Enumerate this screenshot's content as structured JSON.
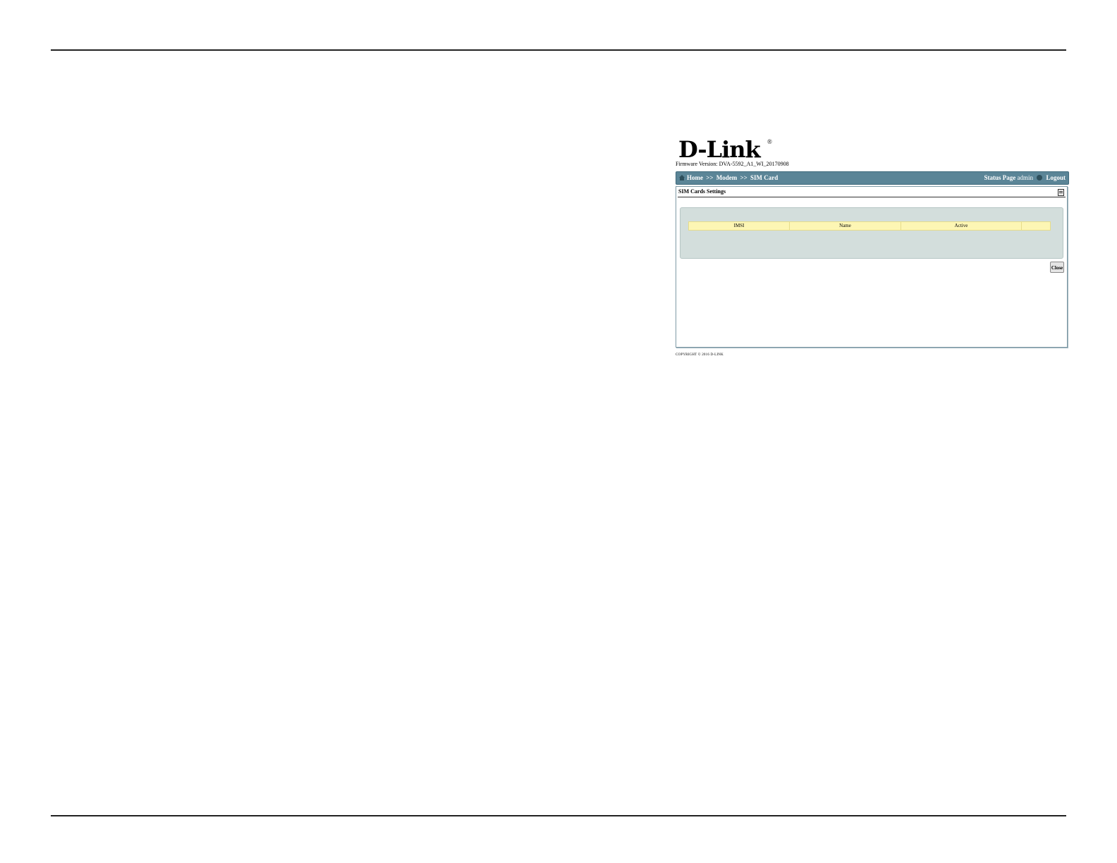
{
  "logo": {
    "text": "D-Link",
    "registered": "®"
  },
  "firmware": "Firmware Version: DVA-5592_A1_WI_20170908",
  "navbar": {
    "breadcrumb": [
      "Home",
      "Modem",
      "SIM Card"
    ],
    "separator": ">>",
    "status_page": "Status Page",
    "user": "admin",
    "logout": "Logout"
  },
  "panel": {
    "title": "SIM Cards Settings",
    "table": {
      "columns": [
        "IMSI",
        "Name",
        "Active",
        ""
      ]
    },
    "close_label": "Close"
  },
  "copyright": "COPYRIGHT © 2016 D-LINK",
  "colors": {
    "navbar_bg": "#5b8597",
    "content_bg": "#d3dedc",
    "table_header_bg": "#fdf6b4"
  }
}
